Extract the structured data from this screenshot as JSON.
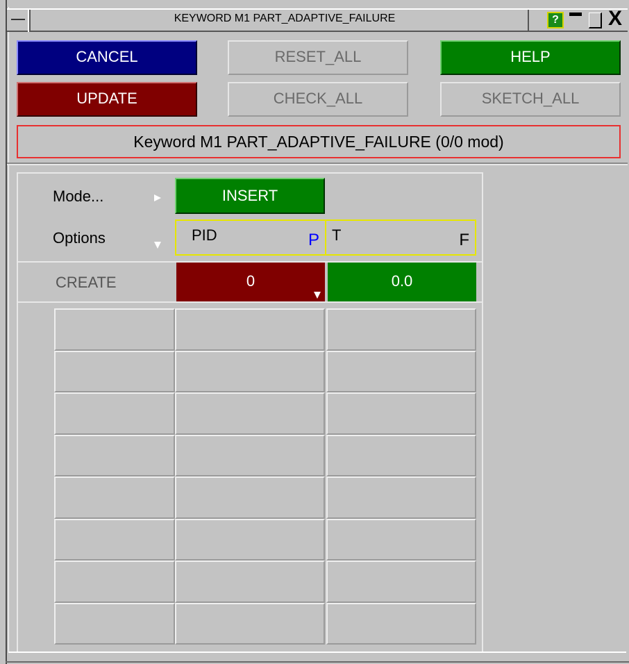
{
  "window": {
    "title": "KEYWORD M1 PART_ADAPTIVE_FAILURE",
    "help_label": "?",
    "close_label": "X"
  },
  "buttons": {
    "cancel": "CANCEL",
    "reset_all": "RESET_ALL",
    "help": "HELP",
    "update": "UPDATE",
    "check_all": "CHECK_ALL",
    "sketch_all": "SKETCH_ALL"
  },
  "status": {
    "text": "Keyword M1 PART_ADAPTIVE_FAILURE (0/0 mod)"
  },
  "editor": {
    "mode_label": "Mode...",
    "mode_value": "INSERT",
    "options_label": "Options",
    "create_label": "CREATE",
    "columns": [
      {
        "name": "PID",
        "tag": "P",
        "tag_color": "#0000ff"
      },
      {
        "name": "T",
        "tag": "F",
        "tag_color": "#000000"
      }
    ],
    "create_values": [
      "0",
      "0.0"
    ],
    "empty_rows": 8
  },
  "colors": {
    "cancel_bg": "#000080",
    "help_bg": "#008000",
    "update_bg": "#800000",
    "status_border": "#e83030",
    "header_border": "#e6e600",
    "pid_value_bg": "#800000",
    "t_value_bg": "#008000"
  }
}
